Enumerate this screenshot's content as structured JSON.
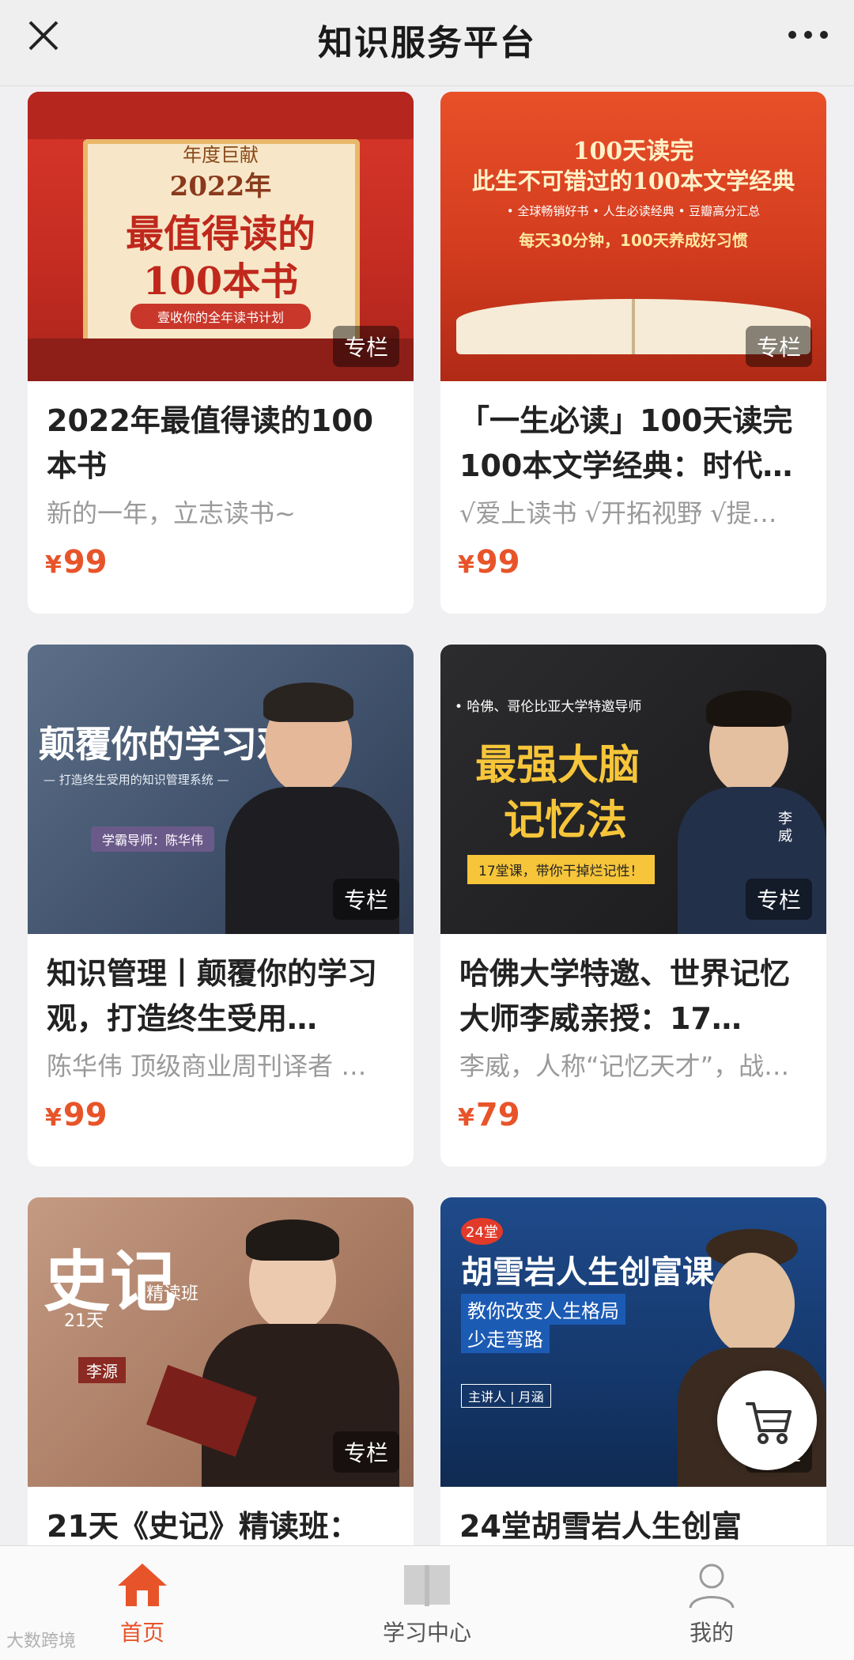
{
  "header": {
    "title": "知识服务平台"
  },
  "cards": [
    {
      "title": "2022年最值得读的100本书",
      "subtitle": "新的一年，立志读书~",
      "price_symbol": "¥",
      "price": "99",
      "badge": "专栏",
      "cover": {
        "line1": "年度巨献",
        "line2": "2022年",
        "line3": "最值得读的",
        "line4": "100本书",
        "line5": "壹收你的全年读书计划"
      }
    },
    {
      "title": "「一生必读」100天读完100本文学经典：时代…",
      "subtitle": "√爱上读书 √开拓视野 √提…",
      "price_symbol": "¥",
      "price": "99",
      "badge": "专栏",
      "cover": {
        "line1": "100天读完",
        "line2": "此生不可错过的100本文学经典",
        "line3": "• 全球畅销好书  • 人生必读经典  • 豆瓣高分汇总",
        "line4": "每天30分钟，100天养成好习惯"
      }
    },
    {
      "title": "知识管理丨颠覆你的学习观，打造终生受用…",
      "subtitle": "陈华伟 顶级商业周刊译者 …",
      "price_symbol": "¥",
      "price": "99",
      "badge": "专栏",
      "cover": {
        "line1": "颠覆你的学习观",
        "line2": "— 打造终生受用的知识管理系统 —",
        "line3": "学霸导师：陈华伟"
      }
    },
    {
      "title": "哈佛大学特邀、世界记忆大师李威亲授：17…",
      "subtitle": "李威，人称“记忆天才”，战…",
      "price_symbol": "¥",
      "price": "79",
      "badge": "专栏",
      "cover": {
        "line1": "• 哈佛、哥伦比亚大学特邀导师",
        "line2": "最强大脑",
        "line3": "记忆法",
        "line4": "17堂课，带你干掉烂记性！",
        "line5": "李威"
      }
    },
    {
      "title": "21天《史记》精读班：",
      "subtitle": "",
      "price_symbol": "",
      "price": "",
      "badge": "专栏",
      "cover": {
        "line1": "史记",
        "line2": "21天",
        "line3": "精读班",
        "line4": "李源"
      }
    },
    {
      "title": "24堂胡雪岩人生创富",
      "subtitle": "",
      "price_symbol": "",
      "price": "",
      "badge": "专栏",
      "cover": {
        "line1": "24堂",
        "line2": "胡雪岩人生创富课",
        "line3": "教你改变人生格局",
        "line4": "少走弯路",
        "line5": "主讲人 | 月涵"
      }
    }
  ],
  "nav": {
    "items": [
      {
        "label": "首页",
        "active": true
      },
      {
        "label": "学习中心",
        "active": false
      },
      {
        "label": "我的",
        "active": false
      }
    ]
  },
  "watermark": "大数跨境",
  "colors": {
    "accent": "#e8542a",
    "nav_active": "#e8542a",
    "nav_inactive": "#555555"
  }
}
